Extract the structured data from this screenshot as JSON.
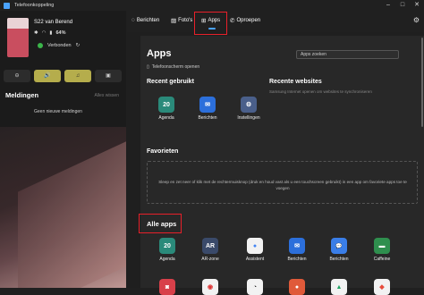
{
  "window": {
    "title": "Telefoonkoppeling",
    "controls": [
      "–",
      "□",
      "✕"
    ]
  },
  "sidebar": {
    "phone_name": "S22 van Berend",
    "battery": "64%",
    "connection": "Verbonden",
    "quick_actions": [
      "⊖",
      "🔊",
      "♫",
      "▣"
    ],
    "notifications_title": "Meldingen",
    "clear_all": "Alles wissen",
    "no_notifications": "Geen nieuwe meldingen"
  },
  "nav": {
    "items": [
      "Berichten",
      "Foto's",
      "Apps",
      "Oproepen"
    ],
    "active": "Apps"
  },
  "apps": {
    "title": "Apps",
    "phone_screen_open": "Telefoonscherm openen",
    "search_placeholder": "Apps zoeken",
    "recent_title": "Recent gebruikt",
    "recent": [
      {
        "label": "Agenda",
        "glyph": "20",
        "color": "#2a8a7a",
        "icon": "calendar-icon"
      },
      {
        "label": "Berichten",
        "glyph": "✉",
        "color": "#2c6fdb",
        "icon": "messages-icon"
      },
      {
        "label": "Instellingen",
        "glyph": "⚙",
        "color": "#4a5f8a",
        "icon": "settings-icon"
      }
    ],
    "recent_web_title": "Recente websites",
    "recent_web_sub": "Samsung Internet openen om websites te synchroniseren",
    "favorites_title": "Favorieten",
    "favorites_hint": "Sleep en zet neer of klik met de rechtermuisknop (druk en houd vast als u een touchscreen gebruikt) in een app om favoriete apps toe te voegen",
    "all_title": "Alle apps",
    "all": [
      {
        "label": "Agenda",
        "glyph": "20",
        "color": "#2a8a7a",
        "icon": "calendar-icon"
      },
      {
        "label": "AR-zone",
        "glyph": "AR",
        "color": "#3a4a6a",
        "icon": "ar-zone-icon"
      },
      {
        "label": "Assistent",
        "glyph": "●",
        "color": "#f2f2f2",
        "icon": "assistant-icon"
      },
      {
        "label": "Berichten",
        "glyph": "✉",
        "color": "#2c6fdb",
        "icon": "messages-icon"
      },
      {
        "label": "Berichten",
        "glyph": "💬",
        "color": "#3a7ee8",
        "icon": "chat-icon"
      },
      {
        "label": "Caffeine",
        "glyph": "▬",
        "color": "#2f8f4e",
        "icon": "caffeine-icon"
      }
    ],
    "row2": [
      {
        "color": "#d8404a",
        "glyph": "◙",
        "icon": "camera-icon"
      },
      {
        "color": "#f2f2f2",
        "glyph": "◉",
        "icon": "chrome-icon"
      },
      {
        "color": "#f2f2f2",
        "glyph": "◔",
        "icon": "clock-icon"
      },
      {
        "color": "#e05a3a",
        "glyph": "●",
        "icon": "contacts-icon"
      },
      {
        "color": "#f2f2f2",
        "glyph": "▲",
        "icon": "drive-icon"
      },
      {
        "color": "#f2f2f2",
        "glyph": "◆",
        "icon": "app-icon"
      }
    ]
  }
}
